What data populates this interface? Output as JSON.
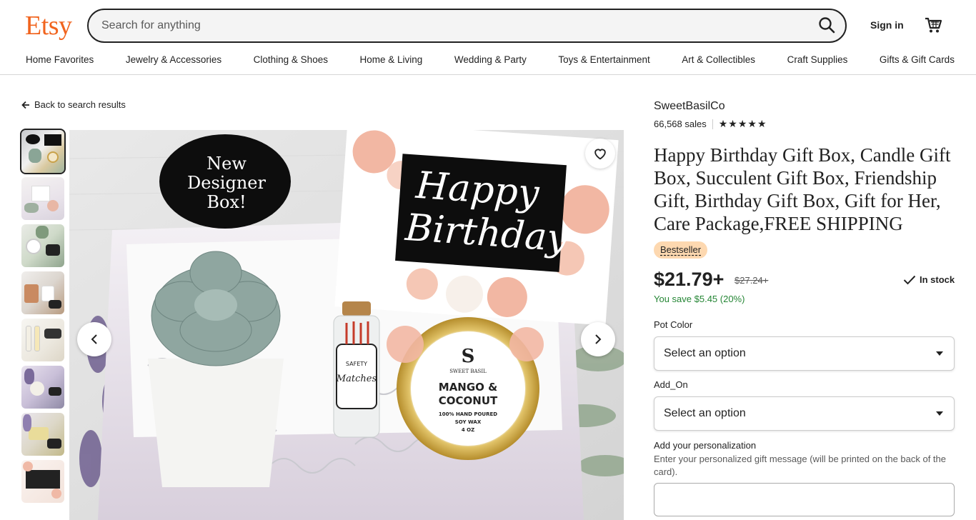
{
  "header": {
    "logo": "Etsy",
    "search_placeholder": "Search for anything",
    "sign_in": "Sign in",
    "nav": [
      "Home Favorites",
      "Jewelry & Accessories",
      "Clothing & Shoes",
      "Home & Living",
      "Wedding & Party",
      "Toys & Entertainment",
      "Art & Collectibles",
      "Craft Supplies",
      "Gifts & Gift Cards"
    ]
  },
  "gallery": {
    "back_label": "Back to search results",
    "image_texts": {
      "badge": "New Designer Box!",
      "card": "Happy Birthday",
      "brand": "SWEET BASIL",
      "candle_line1": "MANGO &",
      "candle_line2": "COCONUT",
      "candle_line3": "100% HAND POURED",
      "candle_line4": "SOY WAX",
      "candle_line5": "4 OZ",
      "matches": "SAFETY Matches"
    }
  },
  "product": {
    "shop_name": "SweetBasilCo",
    "sales": "66,568 sales",
    "rating_stars": "★★★★★",
    "title": "Happy Birthday Gift Box, Candle Gift Box, Succulent Gift Box, Friendship Gift, Birthday Gift Box, Gift for Her, Care Package,FREE SHIPPING",
    "badge": "Bestseller",
    "price": "$21.79+",
    "original_price": "$27.24+",
    "stock": "In stock",
    "savings": "You save $5.45 (20%)",
    "pot_color_label": "Pot Color",
    "pot_color_value": "Select an option",
    "addon_label": "Add_On",
    "addon_value": "Select an option",
    "personalization_label": "Add your personalization",
    "personalization_hint": "Enter your personalized gift message (will be printed on the back of the card)."
  },
  "colors": {
    "brand": "#f1641e",
    "savings": "#258635",
    "badge_bg": "#fdd8b0"
  }
}
